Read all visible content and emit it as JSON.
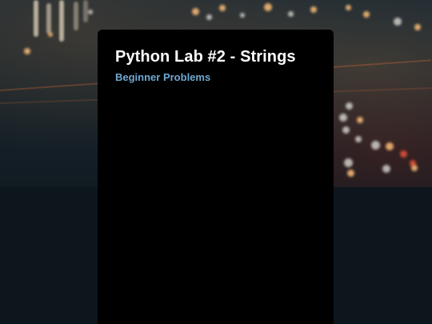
{
  "card": {
    "title": "Python Lab #2 - Strings",
    "subtitle": "Beginner Problems"
  },
  "colors": {
    "page_background": "#0d161c",
    "card_background": "#000000",
    "title_color": "#ffffff",
    "subtitle_color": "#6fa8d1"
  }
}
